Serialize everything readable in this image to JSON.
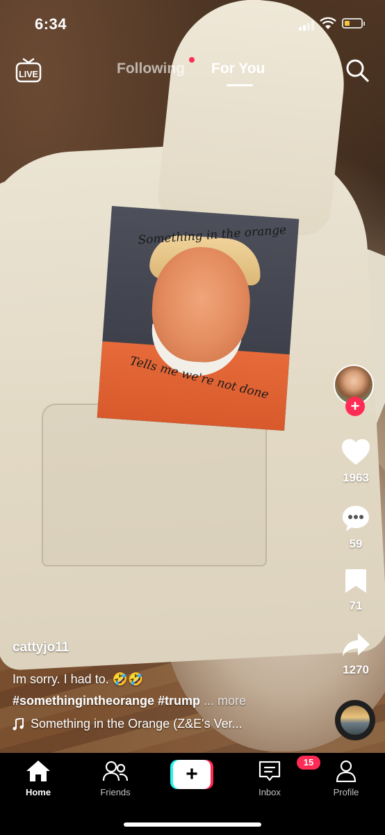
{
  "status_bar": {
    "time": "6:34"
  },
  "top_nav": {
    "live_label": "LIVE",
    "tabs": [
      {
        "label": "Following",
        "active": false,
        "has_dot": true
      },
      {
        "label": "For You",
        "active": true
      }
    ]
  },
  "video": {
    "shirt_caption_top": "Something in the orange",
    "shirt_caption_bottom": "Tells me we're not done"
  },
  "rail": {
    "likes": "1963",
    "comments": "59",
    "saves": "71",
    "shares": "1270"
  },
  "post": {
    "username": "cattyjo11",
    "description": "Im sorry. I had to. 🤣🤣",
    "hashtags": "#somethingintheorange #trump",
    "more_label": "... more",
    "sound": "Something in the Orange (Z&E's Ver..."
  },
  "bottom_nav": {
    "items": [
      {
        "label": "Home",
        "icon": "home-icon",
        "active": true
      },
      {
        "label": "Friends",
        "icon": "friends-icon"
      },
      {
        "label": "",
        "icon": "create-icon"
      },
      {
        "label": "Inbox",
        "icon": "inbox-icon",
        "badge": "15"
      },
      {
        "label": "Profile",
        "icon": "profile-icon"
      }
    ]
  },
  "colors": {
    "accent": "#fe2c55",
    "cyan": "#25f4ee",
    "battery": "#f5c542"
  }
}
